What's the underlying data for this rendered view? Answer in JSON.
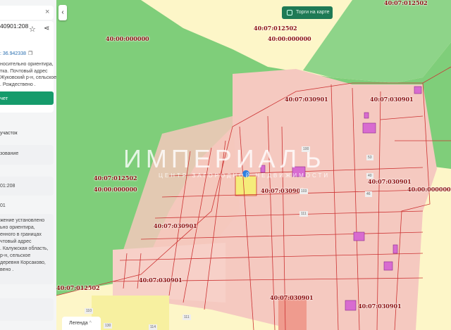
{
  "sidebar": {
    "close": "×",
    "cadastral": "40901:208",
    "coords": ": 36.942338",
    "desc": [
      "носительно ориентира,",
      "тка. Почтовый адрес",
      "Жуковский р-н, сельское",
      ". Рождествено ."
    ],
    "button": "чет",
    "type": "участок",
    "usage": "зование",
    "number": "01:208",
    "quarter": "01",
    "address": [
      "жение установлено",
      "ьно ориентира,",
      "енного в границах",
      "чтовый адрес",
      ". Калужская область,",
      "р-н, сельское",
      "деревня Корсаково,",
      "вено ."
    ]
  },
  "map": {
    "torgi_label": "Торги на карте",
    "legend_label": "Легенда",
    "legend_chevron": "^",
    "collapse": "‹",
    "watermark_title": "ИМПЕРИАЛЪ",
    "watermark_sub": "ЦЕНТР ЗАГОРОДНОЙ НЕДВИЖИМОСТИ",
    "labels": [
      "40:07:012502",
      "40:07:012502",
      "40:00:000000",
      "40:00:000000",
      "40:07:030901",
      "40:07:030901",
      "40:07:030901",
      "40:07:030901",
      "40:07:030901",
      "40:07:030901",
      "40:07:030901",
      "40:07:030901",
      "40:07:012502",
      "40:07:012502",
      "40:00:000000",
      "40:00:000000"
    ],
    "plots": [
      "100",
      "53",
      "40",
      "103",
      "46",
      "111",
      "110",
      "130",
      "114",
      "111"
    ]
  }
}
